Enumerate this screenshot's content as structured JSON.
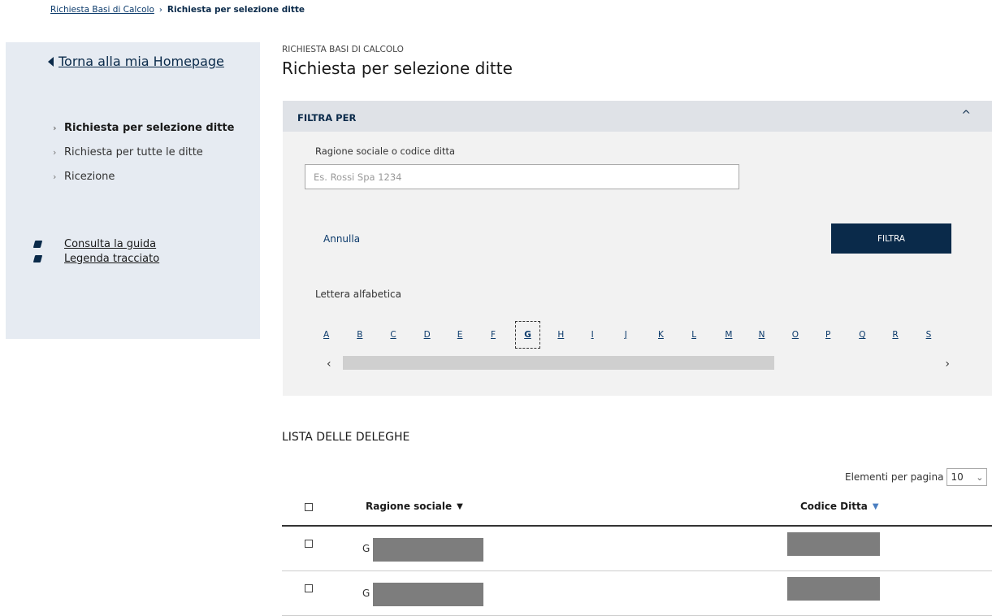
{
  "breadcrumb": {
    "parent": "Richiesta Basi di Calcolo",
    "separator": "›",
    "current": "Richiesta per selezione ditte"
  },
  "sidebar": {
    "back_label": "Torna alla mia Homepage",
    "items": [
      {
        "label": "Richiesta per selezione ditte",
        "active": true
      },
      {
        "label": "Richiesta per tutte le ditte",
        "active": false
      },
      {
        "label": "Ricezione",
        "active": false
      }
    ],
    "guides": [
      {
        "label": "Consulta la guida",
        "icon": "book-icon"
      },
      {
        "label": "Legenda tracciato",
        "icon": "book-icon"
      }
    ]
  },
  "header": {
    "section": "RICHIESTA BASI DI CALCOLO",
    "title": "Richiesta per selezione ditte"
  },
  "filter": {
    "title": "FILTRA PER",
    "field_label": "Ragione sociale o codice ditta",
    "placeholder": "Es. Rossi Spa 1234",
    "cancel_label": "Annulla",
    "submit_label": "FILTRA",
    "alpha_label": "Lettera alfabetica",
    "letters": [
      "A",
      "B",
      "C",
      "D",
      "E",
      "F",
      "G",
      "H",
      "I",
      "J",
      "K",
      "L",
      "M",
      "N",
      "O",
      "P",
      "Q",
      "R",
      "S"
    ],
    "selected_letter": "G"
  },
  "list": {
    "title": "LISTA DELLE DELEGHE",
    "page_size_label": "Elementi per pagina",
    "page_size_value": "10",
    "columns": {
      "name": "Ragione sociale",
      "code": "Codice Ditta"
    },
    "rows": [
      {
        "name_initial": "G"
      },
      {
        "name_initial": "G"
      }
    ]
  },
  "colors": {
    "primary": "#0a2a4a",
    "sidebar_bg": "#e6ebf2",
    "panel_bg": "#f2f2f2",
    "sort_active": "#4a7fc1"
  }
}
